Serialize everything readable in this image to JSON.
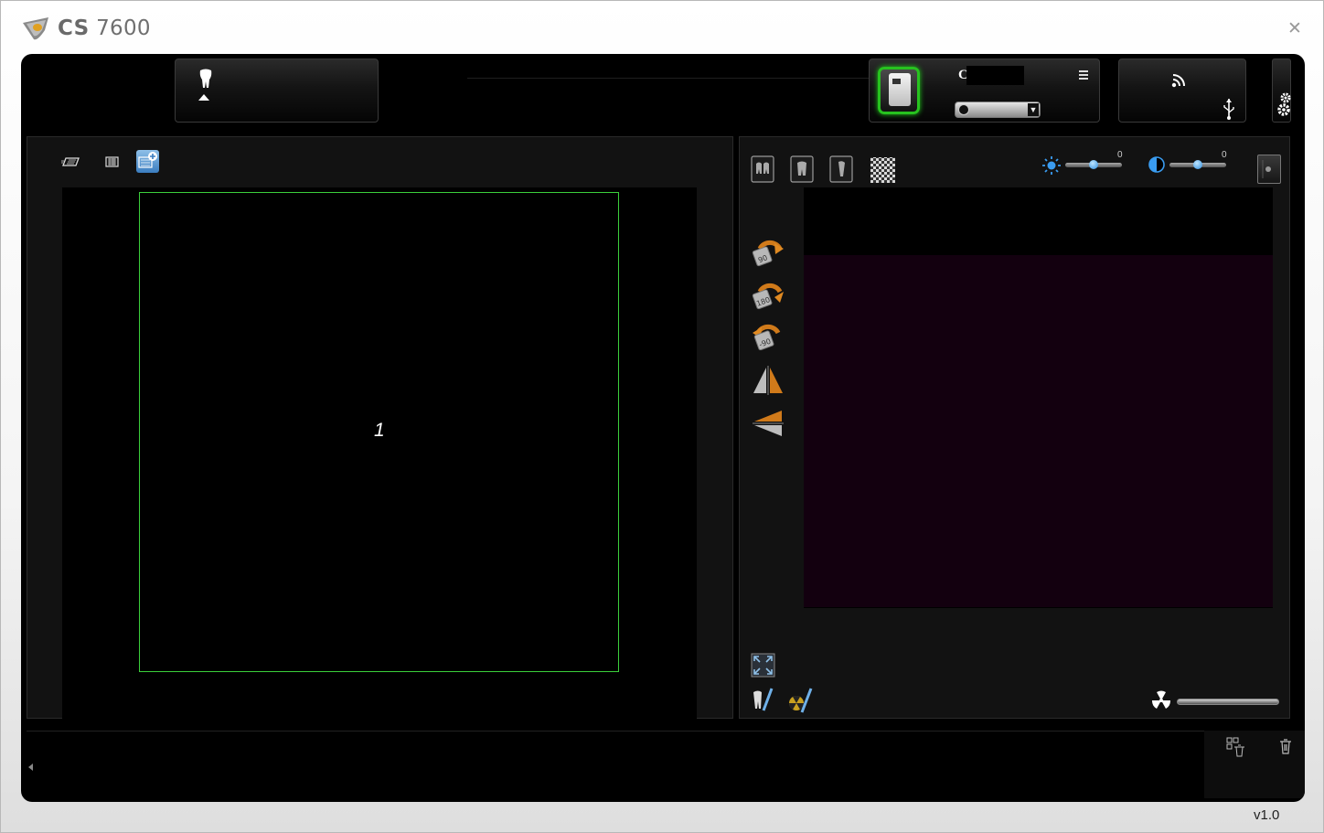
{
  "app": {
    "title_bold": "CS",
    "title_model": "7600",
    "version": "v1.0"
  },
  "title_bar": {
    "close_symbol": "✕"
  },
  "device": {
    "name": "C",
    "status": "connected"
  },
  "left_panel": {
    "slot_label": "1"
  },
  "right_panel": {
    "brightness_value": "0",
    "contrast_value": "0",
    "rotate_buttons": [
      "90",
      "180",
      "-90"
    ]
  },
  "colors": {
    "slot_border": "#3bcf3b",
    "device_status": "#27c21f",
    "preview_bg": "#13000f",
    "slider_knob": "#2d8de0"
  },
  "icons": [
    "tooth-icon",
    "menu-icon",
    "wifi-icon",
    "usb-icon",
    "gear-icon",
    "layout-icon",
    "grid-icon",
    "add-layout-icon",
    "film-icon",
    "checker-icon",
    "brightness-icon",
    "contrast-icon",
    "rotate-icon",
    "flip-horizontal-icon",
    "flip-vertical-icon",
    "fit-screen-icon",
    "radiation-icon",
    "trash-icon"
  ]
}
